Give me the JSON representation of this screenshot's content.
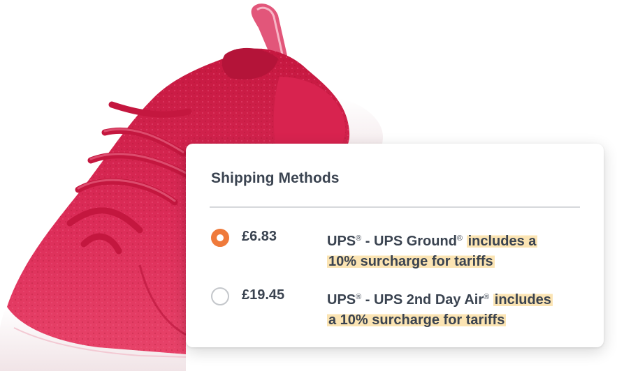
{
  "card": {
    "title": "Shipping Methods"
  },
  "shipping_options": [
    {
      "price": "£6.83",
      "carrier": "UPS",
      "service": "UPS Ground",
      "registered_mark": "®",
      "highlight_line1": "includes a",
      "highlight_line2": "10% surcharge for tariffs",
      "selected": true
    },
    {
      "price": "£19.45",
      "carrier": "UPS",
      "service": "UPS 2nd Day Air",
      "registered_mark": "®",
      "highlight_line1": "includes",
      "highlight_line2": "a 10% surcharge for tariffs",
      "selected": false
    }
  ],
  "separator": "-",
  "colors": {
    "radio_selected": "#ef7a3b",
    "highlight": "#fbe4b3",
    "text": "#3a4350",
    "shoe": "#d8234f"
  },
  "icons": {
    "product": "sneaker-image"
  }
}
